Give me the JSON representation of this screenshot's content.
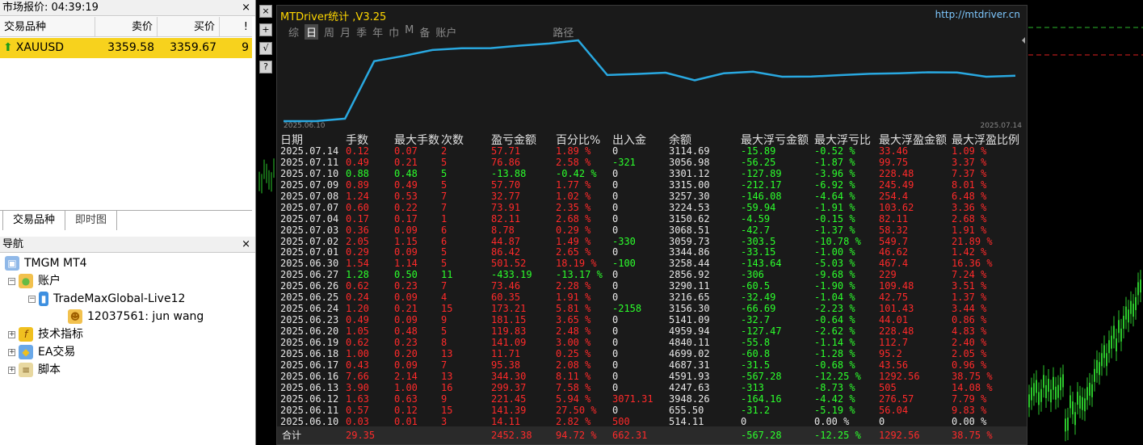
{
  "market_watch": {
    "title": "市场报价: 04:39:19",
    "close": "×",
    "headers": [
      "交易品种",
      "卖价",
      "买价",
      "!"
    ],
    "row": {
      "symbol": "XAUUSD",
      "bid": "3359.58",
      "ask": "3359.67",
      "spread": "9"
    },
    "tabs": [
      "交易品种",
      "即时图"
    ]
  },
  "navigator": {
    "title": "导航",
    "close": "×",
    "items": [
      "TMGM MT4",
      "账户",
      "TradeMaxGlobal-Live12",
      "12037561: jun wang",
      "技术指标",
      "EA交易",
      "脚本"
    ]
  },
  "toolbar": {
    "buttons": [
      "×",
      "+",
      "√",
      "?"
    ]
  },
  "panel": {
    "title": "MTDriver统计 ,V3.25",
    "url": "http://mtdriver.cn",
    "tabs": [
      "综",
      "日",
      "周",
      "月",
      "季",
      "年",
      "巾",
      "M",
      "备",
      "账户",
      "路径"
    ],
    "selected_tab": "日",
    "plot_start": "2025.06.10",
    "plot_end": "2025.07.14",
    "columns": [
      "日期",
      "手数",
      "最大手数",
      "次数",
      "盈亏金额",
      "百分比%",
      "出入金",
      "余额",
      "最大浮亏金额",
      "最大浮亏比",
      "最大浮盈金额",
      "最大浮盈比例"
    ],
    "rows": [
      [
        "2025.07.14",
        "0.12",
        "0.07",
        "2",
        "57.71",
        "1.89 %",
        "0",
        "3114.69",
        "-15.89",
        "-0.52 %",
        "33.46",
        "1.09 %"
      ],
      [
        "2025.07.11",
        "0.49",
        "0.21",
        "5",
        "76.86",
        "2.58 %",
        "-321",
        "3056.98",
        "-56.25",
        "-1.87 %",
        "99.75",
        "3.37 %"
      ],
      [
        "2025.07.10",
        "0.88",
        "0.48",
        "5",
        "-13.88",
        "-0.42 %",
        "0",
        "3301.12",
        "-127.89",
        "-3.96 %",
        "228.48",
        "7.37 %"
      ],
      [
        "2025.07.09",
        "0.89",
        "0.49",
        "5",
        "57.70",
        "1.77 %",
        "0",
        "3315.00",
        "-212.17",
        "-6.92 %",
        "245.49",
        "8.01 %"
      ],
      [
        "2025.07.08",
        "1.24",
        "0.53",
        "7",
        "32.77",
        "1.02 %",
        "0",
        "3257.30",
        "-146.08",
        "-4.64 %",
        "254.4",
        "6.48 %"
      ],
      [
        "2025.07.07",
        "0.60",
        "0.22",
        "7",
        "73.91",
        "2.35 %",
        "0",
        "3224.53",
        "-59.94",
        "-1.91 %",
        "103.62",
        "3.36 %"
      ],
      [
        "2025.07.04",
        "0.17",
        "0.17",
        "1",
        "82.11",
        "2.68 %",
        "0",
        "3150.62",
        "-4.59",
        "-0.15 %",
        "82.11",
        "2.68 %"
      ],
      [
        "2025.07.03",
        "0.36",
        "0.09",
        "6",
        "8.78",
        "0.29 %",
        "0",
        "3068.51",
        "-42.7",
        "-1.37 %",
        "58.32",
        "1.91 %"
      ],
      [
        "2025.07.02",
        "2.05",
        "1.15",
        "6",
        "44.87",
        "1.49 %",
        "-330",
        "3059.73",
        "-303.5",
        "-10.78 %",
        "549.7",
        "21.89 %"
      ],
      [
        "2025.07.01",
        "0.29",
        "0.09",
        "5",
        "86.42",
        "2.65 %",
        "0",
        "3344.86",
        "-33.15",
        "-1.00 %",
        "46.62",
        "1.42 %"
      ],
      [
        "2025.06.30",
        "1.54",
        "1.14",
        "5",
        "501.52",
        "18.19 %",
        "-100",
        "3258.44",
        "-143.64",
        "-5.03 %",
        "467.4",
        "16.36 %"
      ],
      [
        "2025.06.27",
        "1.28",
        "0.50",
        "11",
        "-433.19",
        "-13.17 %",
        "0",
        "2856.92",
        "-306",
        "-9.68 %",
        "229",
        "7.24 %"
      ],
      [
        "2025.06.26",
        "0.62",
        "0.23",
        "7",
        "73.46",
        "2.28 %",
        "0",
        "3290.11",
        "-60.5",
        "-1.90 %",
        "109.48",
        "3.51 %"
      ],
      [
        "2025.06.25",
        "0.24",
        "0.09",
        "4",
        "60.35",
        "1.91 %",
        "0",
        "3216.65",
        "-32.49",
        "-1.04 %",
        "42.75",
        "1.37 %"
      ],
      [
        "2025.06.24",
        "1.20",
        "0.21",
        "15",
        "173.21",
        "5.81 %",
        "-2158",
        "3156.30",
        "-66.69",
        "-2.23 %",
        "101.43",
        "3.44 %"
      ],
      [
        "2025.06.23",
        "0.49",
        "0.09",
        "9",
        "181.15",
        "3.65 %",
        "0",
        "5141.09",
        "-32.7",
        "-0.64 %",
        "44.01",
        "0.86 %"
      ],
      [
        "2025.06.20",
        "1.05",
        "0.48",
        "5",
        "119.83",
        "2.48 %",
        "0",
        "4959.94",
        "-127.47",
        "-2.62 %",
        "228.48",
        "4.83 %"
      ],
      [
        "2025.06.19",
        "0.62",
        "0.23",
        "8",
        "141.09",
        "3.00 %",
        "0",
        "4840.11",
        "-55.8",
        "-1.14 %",
        "112.7",
        "2.40 %"
      ],
      [
        "2025.06.18",
        "1.00",
        "0.20",
        "13",
        "11.71",
        "0.25 %",
        "0",
        "4699.02",
        "-60.8",
        "-1.28 %",
        "95.2",
        "2.05 %"
      ],
      [
        "2025.06.17",
        "0.43",
        "0.09",
        "7",
        "95.38",
        "2.08 %",
        "0",
        "4687.31",
        "-31.5",
        "-0.68 %",
        "43.56",
        "0.96 %"
      ],
      [
        "2025.06.16",
        "7.66",
        "2.14",
        "13",
        "344.30",
        "8.11 %",
        "0",
        "4591.93",
        "-567.28",
        "-12.25 %",
        "1292.56",
        "38.75 %"
      ],
      [
        "2025.06.13",
        "3.90",
        "1.00",
        "16",
        "299.37",
        "7.58 %",
        "0",
        "4247.63",
        "-313",
        "-8.73 %",
        "505",
        "14.08 %"
      ],
      [
        "2025.06.12",
        "1.63",
        "0.63",
        "9",
        "221.45",
        "5.94 %",
        "3071.31",
        "3948.26",
        "-164.16",
        "-4.42 %",
        "276.57",
        "7.79 %"
      ],
      [
        "2025.06.11",
        "0.57",
        "0.12",
        "15",
        "141.39",
        "27.50 %",
        "0",
        "655.50",
        "-31.2",
        "-5.19 %",
        "56.04",
        "9.83 %"
      ],
      [
        "2025.06.10",
        "0.03",
        "0.01",
        "3",
        "14.11",
        "2.82 %",
        "500",
        "514.11",
        "0",
        "0.00 %",
        "0",
        "0.00 %"
      ]
    ],
    "total": {
      "label": "合计",
      "lots": "29.35",
      "pnl": "2452.38",
      "pct": "94.72 %",
      "flow": "662.31",
      "maxloss": "-567.28",
      "maxlosspct": "-12.25 %",
      "maxprofit": "1292.56",
      "maxprofitpct": "38.75 %"
    },
    "colors": {
      "positive": "#ff2a2a",
      "negative": "#2cff2c",
      "line": "#29a8e0",
      "title": "#ffd700"
    }
  }
}
